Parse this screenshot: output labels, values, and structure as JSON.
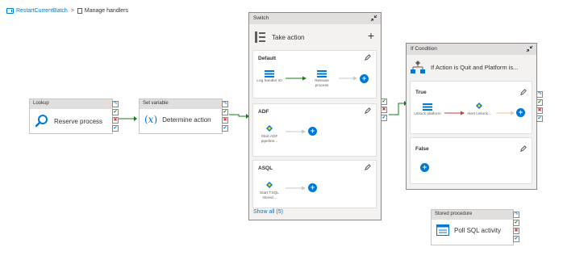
{
  "breadcrumb": {
    "pipeline": "RestartCurrentBatch",
    "separator": ">",
    "page": "Manage handlers"
  },
  "lookup": {
    "type": "Lookup",
    "name": "Reserve process"
  },
  "set_variable": {
    "type": "Set variable",
    "name": "Determine action"
  },
  "switch": {
    "type": "Switch",
    "name": "Take action",
    "cases": [
      {
        "title": "Default",
        "activities": [
          "Log handler ID",
          "Release process"
        ]
      },
      {
        "title": "ADF",
        "activities": [
          "Start ADF pipeline..."
        ]
      },
      {
        "title": "ASQL",
        "activities": [
          "Start TSQL stored..."
        ]
      }
    ],
    "show_all": "Show all (5)"
  },
  "if_condition": {
    "type": "If Condition",
    "name": "If Action is Quit and Platform is...",
    "true_title": "True",
    "true_activities": [
      "Unlock platform",
      "Alert Unlock..."
    ],
    "false_title": "False"
  },
  "stored_procedure": {
    "type": "Stored procedure",
    "name": "Poll SQL activity"
  },
  "colors": {
    "accent": "#0078d4",
    "success": "#107c10",
    "failure": "#d13438",
    "header": "#e1dfdd"
  }
}
